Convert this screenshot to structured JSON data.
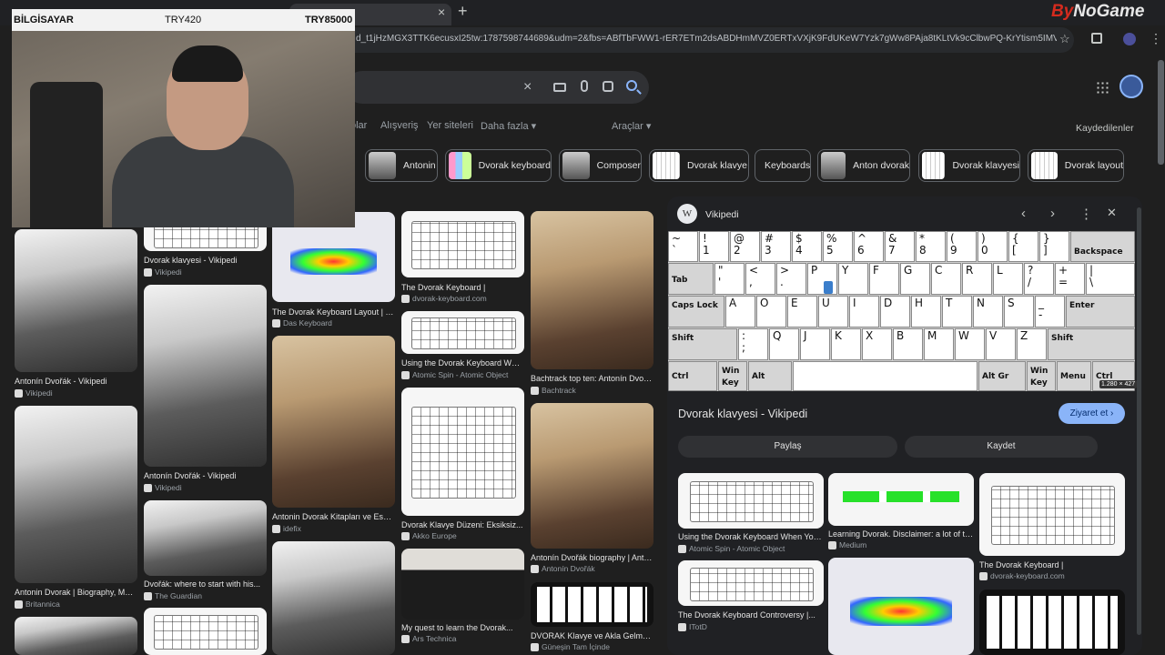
{
  "browser": {
    "tab_close": "×",
    "new_tab": "+",
    "url": "d_t1jHzMGX3TTK6ecusxI25tw:1787598744689&udm=2&fbs=ABfTbFWW1-rER7ETm2dsABDHmMVZ0ERTxVXjK9FdUKeW7Yzk7gWw8PAja8tKLtVk9cClbwPQ-KrYtism5IMVP3cr8r-UU37sO...",
    "star": "☆",
    "menu": "⋮",
    "logo_by": "By",
    "logo_rest": "NoGame"
  },
  "search": {
    "clear": "×"
  },
  "nav": {
    "items": [
      "olar",
      "Alışveriş",
      "Yer siteleri",
      "Daha fazla ▾",
      "Araçlar ▾"
    ],
    "saved": "Kaydedilenler"
  },
  "chips": [
    "Antonin",
    "Dvorak keyboard",
    "Composer",
    "Dvorak klavye",
    "Keyboards",
    "Anton dvorak",
    "Dvorak klavyesi",
    "Dvorak layout"
  ],
  "webcam": {
    "label_left": "BİLGİSAYAR",
    "label_mid": "TRY420",
    "label_right": "TRY85000"
  },
  "results": [
    {
      "title": "Antonín Dvořák - Vikipedi",
      "source": "Vikipedi"
    },
    {
      "title": "Dvorak klavyesi - Vikipedi",
      "source": "Vikipedi"
    },
    {
      "title": "The Dvorak Keyboard Layout | Da...",
      "source": "Das Keyboard"
    },
    {
      "title": "The Dvorak Keyboard |",
      "source": "dvorak-keyboard.com"
    },
    {
      "title": "Using the Dvorak Keyboard When...",
      "source": "Atomic Spin - Atomic Object"
    },
    {
      "title": "Bachtrack top ten: Antonín Dvořák...",
      "source": "Bachtrack"
    },
    {
      "title": "Antonín Dvořák - Vikipedi",
      "source": "Vikipedi"
    },
    {
      "title": "Antonin Dvorak Kitapları ve Eserleri",
      "source": "idefix"
    },
    {
      "title": "Dvorak Klavye Düzeni: Eksiksiz...",
      "source": "Akko Europe"
    },
    {
      "title": "Antonín Dvořák biography | Antonín...",
      "source": "Antonín Dvořák"
    },
    {
      "title": "Antonin Dvorak | Biography, Music...",
      "source": "Britannica"
    },
    {
      "title": "Dvořák: where to start with his...",
      "source": "The Guardian"
    },
    {
      "title": "My quest to learn the Dvorak...",
      "source": "Ars Technica"
    },
    {
      "title": "DVORAK Klavye ve Akla Gelmedi...",
      "source": "Güneşin Tam İçinde"
    }
  ],
  "panel": {
    "site": "Vikipedi",
    "wiki_letter": "W",
    "prev": "‹",
    "next": "›",
    "more": "⋮",
    "close": "✕",
    "dimensions": "1.280 × 427",
    "title": "Dvorak klavyesi - Vikipedi",
    "visit": "Ziyaret et ›",
    "share": "Paylaş",
    "save": "Kaydet",
    "related": [
      {
        "title": "Using the Dvorak Keyboard When You...",
        "source": "Atomic Spin - Atomic Object"
      },
      {
        "title": "Learning Dvorak. Disclaimer: a lot of the...",
        "source": "Medium"
      },
      {
        "title": "The Dvorak Keyboard |",
        "source": "dvorak-keyboard.com"
      },
      {
        "title": "The Dvorak Keyboard Controversy |...",
        "source": "ITotD"
      }
    ]
  },
  "keyboard": {
    "row1": [
      "~\n`",
      "!\n1",
      "@\n2",
      "#\n3",
      "$\n4",
      "%\n5",
      "^\n6",
      "&\n7",
      "*\n8",
      "(\n9",
      ")\n0",
      "{\n[",
      "}\n]"
    ],
    "backspace": "Backspace",
    "tab": "Tab",
    "row2": [
      "\"\n'",
      "<\n,",
      ">\n.",
      "P",
      "Y",
      "F",
      "G",
      "C",
      "R",
      "L",
      "?\n/",
      "+\n=",
      "|\n\\"
    ],
    "caps": "Caps Lock",
    "row3": [
      "A",
      "O",
      "E",
      "U",
      "I",
      "D",
      "H",
      "T",
      "N",
      "S",
      "_\n-"
    ],
    "enter": "Enter",
    "shift": "Shift",
    "row4": [
      ":\n;",
      "Q",
      "J",
      "K",
      "X",
      "B",
      "M",
      "W",
      "V",
      "Z"
    ],
    "ctrl": "Ctrl",
    "win": "Win\nKey",
    "alt": "Alt",
    "altgr": "Alt Gr",
    "menu": "Menu"
  }
}
